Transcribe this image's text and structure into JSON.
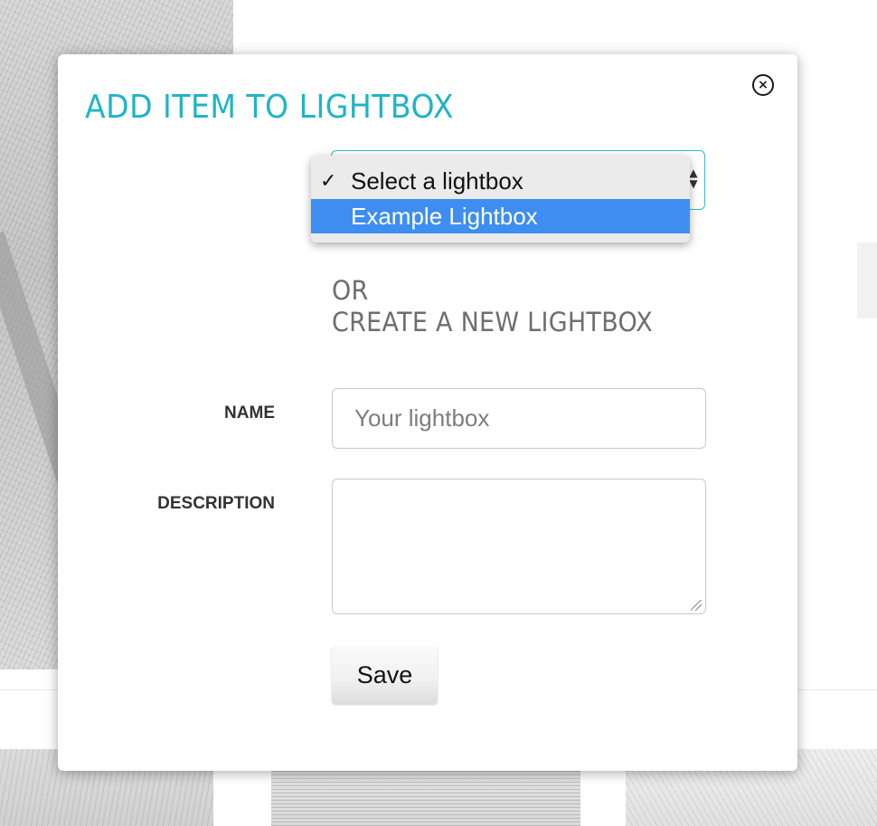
{
  "modal": {
    "title": "ADD ITEM TO LIGHTBOX",
    "close_icon": "close-icon"
  },
  "lightbox_select": {
    "selected_value": "Select a lightbox",
    "options": [
      {
        "label": "Select a lightbox",
        "checked": true,
        "highlighted": false
      },
      {
        "label": "Example Lightbox",
        "checked": false,
        "highlighted": true
      }
    ],
    "check_mark": "✓",
    "highlight_color": "#3d8ef0"
  },
  "create_section": {
    "or_text": "OR",
    "heading": "CREATE A NEW LIGHTBOX"
  },
  "form": {
    "name_label": "NAME",
    "name_placeholder": "Your lightbox",
    "name_value": "",
    "description_label": "DESCRIPTION",
    "description_value": "",
    "save_label": "Save"
  },
  "colors": {
    "accent": "#1fb4c8",
    "select_border": "#36b8c8"
  }
}
